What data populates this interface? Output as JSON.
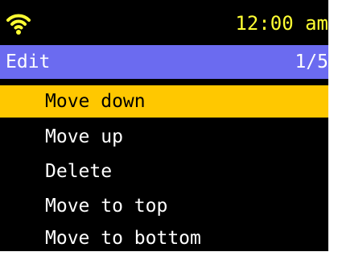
{
  "status_bar": {
    "wifi_icon": "wifi-icon",
    "time": "12:00 am",
    "time_color": "#ffff33"
  },
  "title_bar": {
    "title": "Edit",
    "page_indicator": "1/5",
    "background_color": "#6b6bf0"
  },
  "menu": {
    "selected_index": 0,
    "selected_color": "#ffc800",
    "items": [
      {
        "label": "Move down"
      },
      {
        "label": "Move up"
      },
      {
        "label": "Delete"
      },
      {
        "label": "Move to top"
      },
      {
        "label": "Move to bottom"
      }
    ]
  }
}
